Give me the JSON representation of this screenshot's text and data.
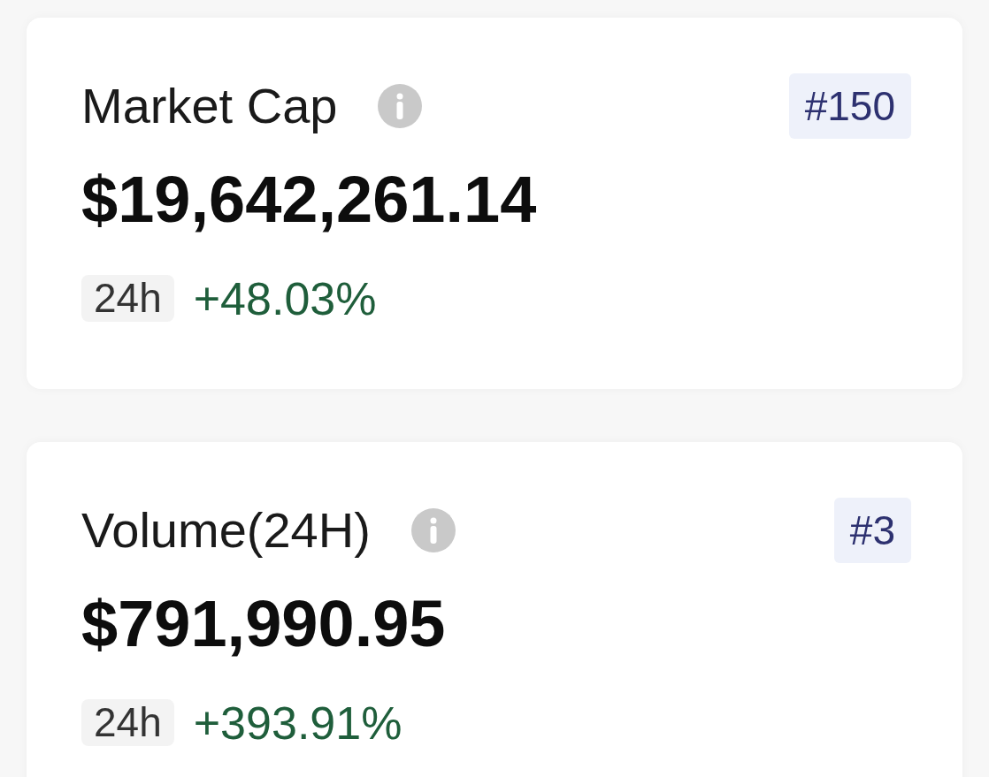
{
  "metrics": [
    {
      "title": "Market Cap",
      "rank": "#150",
      "value": "$19,642,261.14",
      "period": "24h",
      "change": "+48.03%",
      "rising": true
    },
    {
      "title": "Volume(24H)",
      "rank": "#3",
      "value": "$791,990.95",
      "period": "24h",
      "change": "+393.91%",
      "rising": true
    }
  ]
}
